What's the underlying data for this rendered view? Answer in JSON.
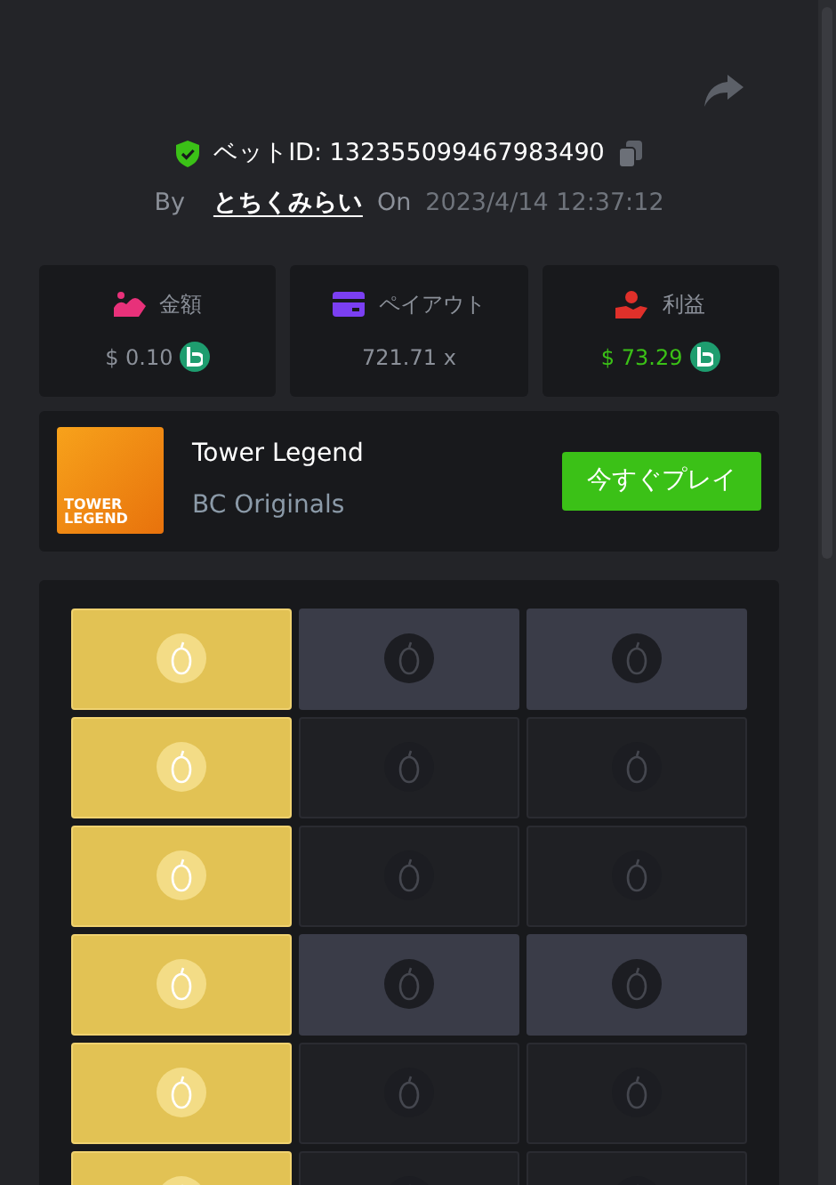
{
  "bet": {
    "id_label": "ベットID: 132355099467983490",
    "by_label": "By",
    "user": "とちくみらい",
    "on_label": "On",
    "date": "2023/4/14 12:37:12"
  },
  "stats": [
    {
      "kind": "amount",
      "label": "金額",
      "value": "$ 0.10",
      "coin": true,
      "positive": false
    },
    {
      "kind": "payout",
      "label": "ペイアウト",
      "value": "721.71 x",
      "coin": false,
      "positive": false
    },
    {
      "kind": "profit",
      "label": "利益",
      "value": "$ 73.29",
      "coin": true,
      "positive": true
    }
  ],
  "game": {
    "logo_text": "TOWER LEGEND",
    "title": "Tower Legend",
    "provider": "BC Originals",
    "play_button": "今すぐプレイ"
  },
  "grid": {
    "rows": [
      {
        "lit": true,
        "tiles": [
          {
            "selected": true
          },
          {
            "selected": false
          },
          {
            "selected": false
          }
        ]
      },
      {
        "lit": false,
        "tiles": [
          {
            "selected": true
          },
          {
            "selected": false
          },
          {
            "selected": false
          }
        ]
      },
      {
        "lit": false,
        "tiles": [
          {
            "selected": true
          },
          {
            "selected": false
          },
          {
            "selected": false
          }
        ]
      },
      {
        "lit": true,
        "tiles": [
          {
            "selected": true
          },
          {
            "selected": false
          },
          {
            "selected": false
          }
        ]
      },
      {
        "lit": false,
        "tiles": [
          {
            "selected": true
          },
          {
            "selected": false
          },
          {
            "selected": false
          }
        ]
      },
      {
        "lit": false,
        "tiles": [
          {
            "selected": true
          },
          {
            "selected": false
          },
          {
            "selected": false
          }
        ]
      }
    ]
  }
}
